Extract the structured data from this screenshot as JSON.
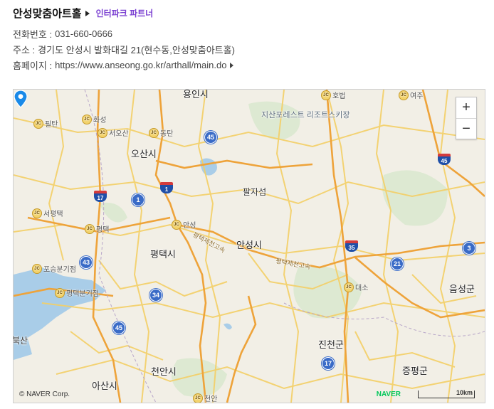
{
  "place": {
    "name": "안성맞춤아트홀",
    "partner": "인터파크 파트너",
    "phone_label": "전화번호 :",
    "phone": "031-660-0666",
    "address_label": "주소 :",
    "address": "경기도 안성시 발화대길 21(현수동,안성맞춤아트홀)",
    "homepage_label": "홈페이지 :",
    "homepage": "https://www.anseong.go.kr/arthall/main.do"
  },
  "map": {
    "zoom_in": "+",
    "zoom_out": "−",
    "copyright": "© NAVER Corp.",
    "brand": "NAVER",
    "scale": "10km",
    "cities": [
      "오산시",
      "평택시",
      "안성시",
      "진천군",
      "천안시",
      "아산시",
      "음성군",
      "증평군",
      "팔자섬"
    ],
    "places": [
      "용인시",
      "지산포레스트 리조트스키장",
      "호법",
      "여주",
      "화성",
      "서오산",
      "동탄",
      "필탄",
      "서평택",
      "평택",
      "안성",
      "포승분기점",
      "평택분기점",
      "대소",
      "천안",
      "북산"
    ],
    "roads": [
      "평택제천고속",
      "평택제천고속"
    ],
    "route_numbers": [
      "45",
      "1",
      "17",
      "43",
      "34",
      "45",
      "17",
      "35",
      "21",
      "3",
      "1",
      "45"
    ],
    "marker": "venue-location"
  },
  "colors": {
    "accent": "#7a3fd1",
    "marker": "#1a8ae8",
    "naver": "#03c75a"
  }
}
